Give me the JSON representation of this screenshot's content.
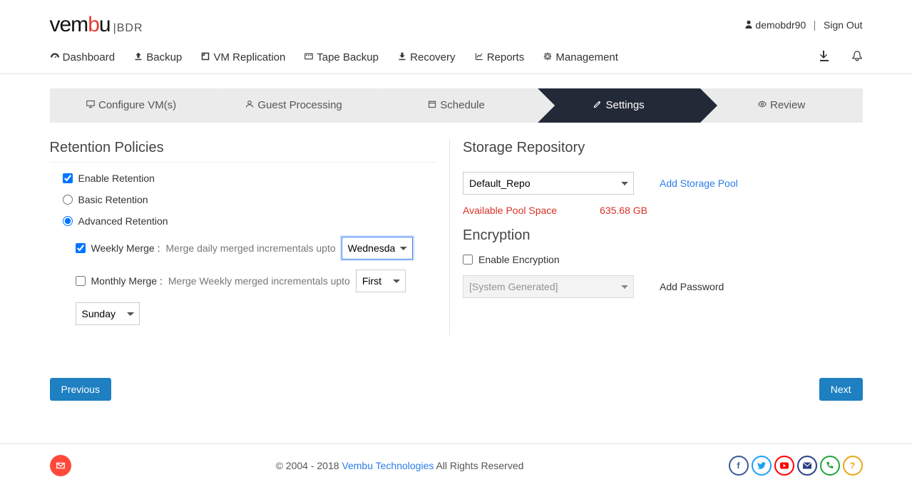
{
  "header": {
    "logo_main": "vembu",
    "logo_sub": "|BDR",
    "username": "demobdr90",
    "signout": "Sign Out"
  },
  "nav": {
    "items": [
      {
        "label": "Dashboard"
      },
      {
        "label": "Backup"
      },
      {
        "label": "VM Replication"
      },
      {
        "label": "Tape Backup"
      },
      {
        "label": "Recovery"
      },
      {
        "label": "Reports"
      },
      {
        "label": "Management"
      }
    ]
  },
  "wizard": {
    "steps": [
      {
        "label": "Configure VM(s)"
      },
      {
        "label": "Guest Processing"
      },
      {
        "label": "Schedule"
      },
      {
        "label": "Settings",
        "active": true
      },
      {
        "label": "Review"
      }
    ]
  },
  "retention": {
    "title": "Retention Policies",
    "enable_label": "Enable Retention",
    "basic_label": "Basic Retention",
    "advanced_label": "Advanced Retention",
    "weekly_merge_label": "Weekly Merge :",
    "weekly_merge_desc": "Merge daily merged incrementals upto",
    "weekly_day": "Wednesday",
    "monthly_merge_label": "Monthly Merge :",
    "monthly_merge_desc": "Merge Weekly merged incrementals upto",
    "monthly_week": "First",
    "monthly_day": "Sunday"
  },
  "storage": {
    "title": "Storage Repository",
    "repo": "Default_Repo",
    "add_pool": "Add Storage Pool",
    "avail_label": "Available Pool Space",
    "avail_value": "635.68 GB"
  },
  "encryption": {
    "title": "Encryption",
    "enable_label": "Enable Encryption",
    "password_select": "[System Generated]",
    "add_password": "Add Password"
  },
  "buttons": {
    "prev": "Previous",
    "next": "Next"
  },
  "footer": {
    "copy_prefix": "© 2004 - 2018 ",
    "company": "Vembu Technologies",
    "copy_suffix": " All Rights Reserved"
  }
}
